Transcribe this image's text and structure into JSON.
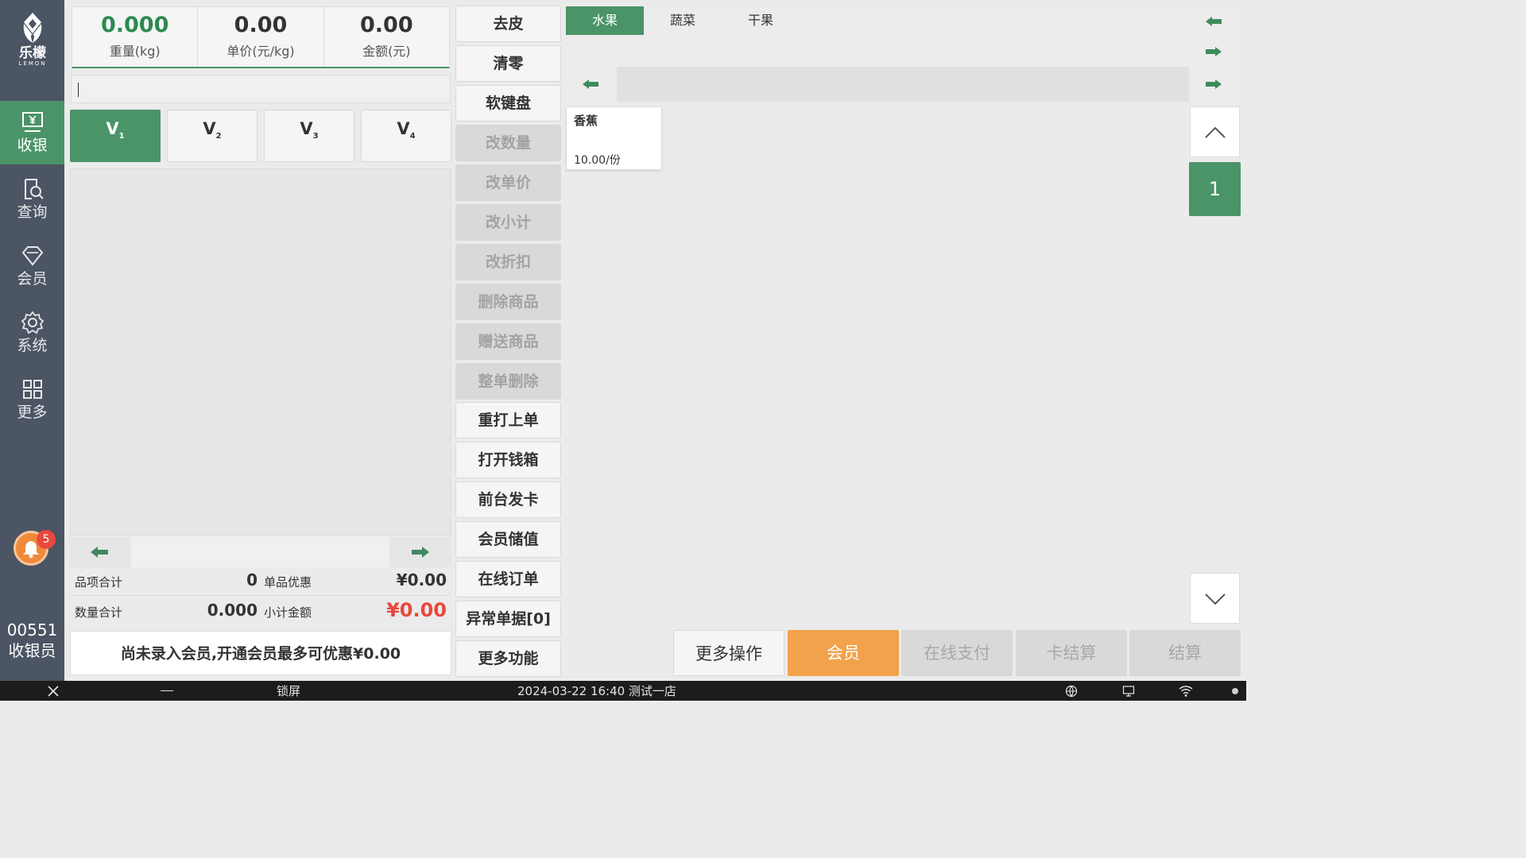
{
  "brand": {
    "name": "乐檬",
    "sub": "LEMON"
  },
  "sidebar": {
    "items": [
      {
        "label": "收银",
        "icon": "cashier-icon"
      },
      {
        "label": "查询",
        "icon": "query-icon"
      },
      {
        "label": "会员",
        "icon": "diamond-icon"
      },
      {
        "label": "系统",
        "icon": "gear-icon"
      },
      {
        "label": "更多",
        "icon": "grid-icon"
      }
    ],
    "notification_count": "5",
    "user_id": "00551",
    "user_role": "收银员"
  },
  "display": {
    "weight_value": "0.000",
    "weight_label": "重量(kg)",
    "unit_price_value": "0.00",
    "unit_price_label": "单价(元/kg)",
    "amount_value": "0.00",
    "amount_label": "金额(元)"
  },
  "vtabs": [
    {
      "label": "V",
      "sub": "1"
    },
    {
      "label": "V",
      "sub": "2"
    },
    {
      "label": "V",
      "sub": "3"
    },
    {
      "label": "V",
      "sub": "4"
    }
  ],
  "totals": {
    "items_label": "品项合计",
    "items_value": "0",
    "discount_label": "单品优惠",
    "discount_value": "¥0.00",
    "qty_label": "数量合计",
    "qty_value": "0.000",
    "subtotal_label": "小计金额",
    "subtotal_value": "¥0.00"
  },
  "member_note": "尚未录入会员,开通会员最多可优惠¥0.00",
  "functions": [
    {
      "label": "去皮",
      "enabled": true
    },
    {
      "label": "清零",
      "enabled": true
    },
    {
      "label": "软键盘",
      "enabled": true
    },
    {
      "label": "改数量",
      "enabled": false
    },
    {
      "label": "改单价",
      "enabled": false
    },
    {
      "label": "改小计",
      "enabled": false
    },
    {
      "label": "改折扣",
      "enabled": false
    },
    {
      "label": "删除商品",
      "enabled": false
    },
    {
      "label": "赠送商品",
      "enabled": false
    },
    {
      "label": "整单删除",
      "enabled": false
    },
    {
      "label": "重打上单",
      "enabled": true
    },
    {
      "label": "打开钱箱",
      "enabled": true
    },
    {
      "label": "前台发卡",
      "enabled": true
    },
    {
      "label": "会员储值",
      "enabled": true
    },
    {
      "label": "在线订单",
      "enabled": true
    },
    {
      "label": "异常单据[0]",
      "enabled": true
    },
    {
      "label": "更多功能",
      "enabled": true
    }
  ],
  "categories": [
    "水果",
    "蔬菜",
    "干果"
  ],
  "products": [
    {
      "name": "香蕉",
      "price": "10.00/份"
    }
  ],
  "page": {
    "current": "1"
  },
  "bottom_actions": {
    "more_ops": "更多操作",
    "member": "会员",
    "online_pay": "在线支付",
    "card_checkout": "卡结算",
    "checkout": "结算"
  },
  "taskbar": {
    "lock": "锁屏",
    "status": "2024-03-22 16:40 测试一店"
  },
  "colors": {
    "accent_green": "#4a9468",
    "sidebar": "#4b5563",
    "orange": "#f2a24a",
    "red": "#e8483d"
  }
}
